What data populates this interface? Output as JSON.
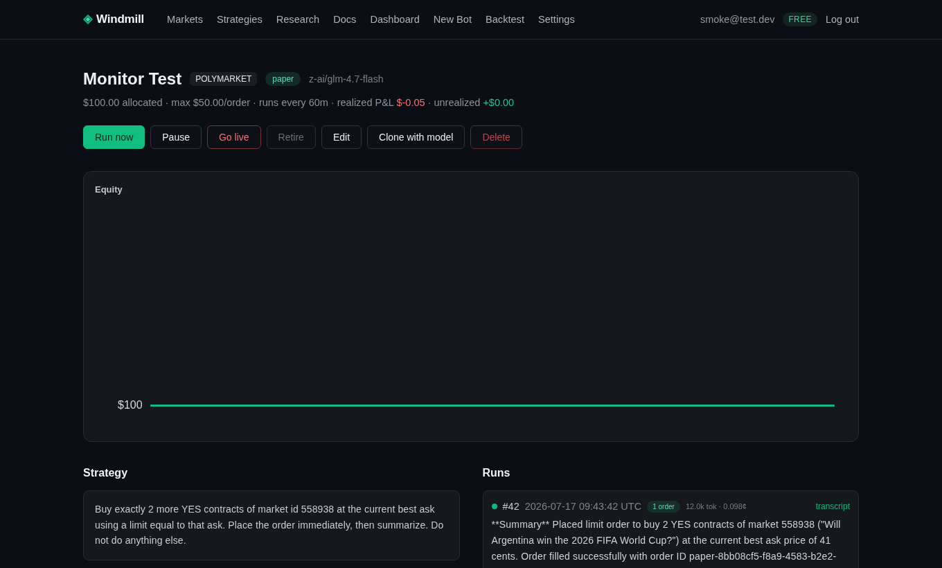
{
  "header": {
    "logo": "Windmill",
    "nav": [
      {
        "label": "Markets",
        "selected": false
      },
      {
        "label": "Strategies",
        "selected": false
      },
      {
        "label": "Research",
        "selected": false
      },
      {
        "label": "Docs",
        "selected": false
      },
      {
        "label": "Dashboard",
        "selected": false
      },
      {
        "label": "New Bot",
        "selected": false
      },
      {
        "label": "Backtest",
        "selected": false
      },
      {
        "label": "Settings",
        "selected": false
      }
    ],
    "user_email": "smoke@test.dev",
    "plan": "FREE",
    "logout": "Log out"
  },
  "bot": {
    "title": "Monitor Test",
    "venue": "POLYMARKET",
    "mode": "paper",
    "model": "z-ai/glm-4.7-flash",
    "stats": [
      {
        "text": "$100.00 allocated · max $50.00/order · runs every 60m · realized P&L",
        "kind": "muted"
      },
      {
        "text": "$-0.05",
        "kind": "negative"
      },
      {
        "text": "· unrealized",
        "kind": "muted"
      },
      {
        "text": "+$0.00",
        "kind": "positive"
      }
    ],
    "actions": [
      {
        "label": "Run now",
        "kind": "primary",
        "disabled": false
      },
      {
        "label": "Pause",
        "kind": "secondary",
        "disabled": false
      },
      {
        "label": "Go live",
        "kind": "live",
        "disabled": false
      },
      {
        "label": "Retire",
        "kind": "secondary",
        "disabled": true
      },
      {
        "label": "Edit",
        "kind": "secondary",
        "disabled": false
      },
      {
        "label": "Clone with model",
        "kind": "secondary",
        "disabled": false
      },
      {
        "label": "Delete",
        "kind": "danger",
        "disabled": false
      }
    ]
  },
  "equity": {
    "title": "Equity",
    "line_label": "$100"
  },
  "strategy": {
    "heading": "Strategy",
    "text": "Buy exactly 2 more YES contracts of market id 558938 at the current best ask using a limit equal to that ask. Place the order immediately, then summarize. Do not do anything else."
  },
  "runs": {
    "heading": "Runs",
    "items": [
      {
        "color": "#10b981",
        "number": "#42",
        "timestamp": "2026-07-17 09:43:42 UTC",
        "orders": "1 order",
        "usage": "12.0k tok · 0.098¢",
        "link": "transcript",
        "summary": "**Summary** Placed limit order to buy 2 YES contracts of market 558938 (\"Will Argentina win the 2026 FIFA World Cup?\") at the current best ask price of 41 cents. Order filled successfully with order ID paper-8bb08cf5-f8a9-4583-b2e2-"
      }
    ]
  }
}
